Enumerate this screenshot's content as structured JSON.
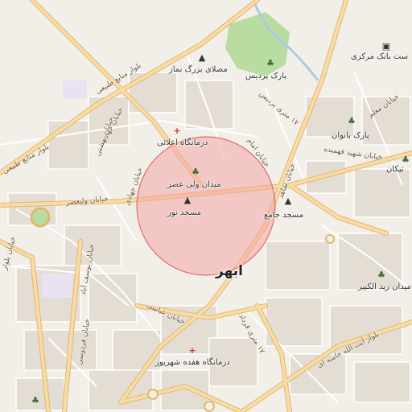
{
  "map": {
    "city": "ابهر",
    "colors": {
      "background": "#f2efe9",
      "block": "#e4ddd3",
      "street": "#ffffff",
      "major_road": "#f5d9a0",
      "major_road_casing": "#e3b66f",
      "park": "#b9dca1",
      "water": "#a9c9e8",
      "highlight_fill": "#f4a6a6",
      "highlight_stroke": "#e26b6b"
    },
    "pois": [
      {
        "name": "مصلای بزرگ نماز",
        "icon": "mosque-icon"
      },
      {
        "name": "پارک پردیس",
        "icon": "park-icon"
      },
      {
        "name": "ست بانک مرکزی",
        "icon": "bank-icon"
      },
      {
        "name": "درمانگاه اعلائی",
        "icon": "hospital-icon"
      },
      {
        "name": "پارک بانوان",
        "icon": "park-icon"
      },
      {
        "name": "تیکان",
        "icon": "park-icon"
      },
      {
        "name": "میدان ولی عصر",
        "icon": "park-icon"
      },
      {
        "name": "مسجد نور",
        "icon": "mosque-icon"
      },
      {
        "name": "مسجد جامع",
        "icon": "mosque-icon"
      },
      {
        "name": "میدان زید الکبیر",
        "icon": "park-icon"
      },
      {
        "name": "درمانگاه هفده شهریور",
        "icon": "hospital-icon"
      }
    ],
    "roads": [
      "بلوار منابع طبیعی",
      "بلوار منابع طبیعی",
      "خیابان جهاد",
      "خیابان بهشتی",
      "خیابان ولیعصر",
      "خیابان جهادی",
      "خیابان امام",
      "۱۷ متری پردیس",
      "خیابان شهید فهمیده",
      "خیابان شاهد",
      "خیابان معلم",
      "خیابان یوسف آباد",
      "خیابان فردوسی",
      "خیابان عباسی",
      "۱۷ متری قرداد",
      "بلوار آیت الله خامنه ای",
      "خیابان بلوار"
    ]
  }
}
